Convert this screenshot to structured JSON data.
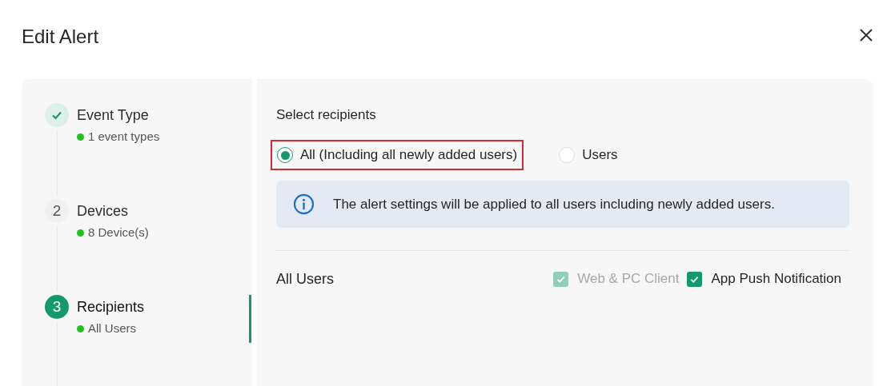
{
  "dialog": {
    "title": "Edit Alert"
  },
  "steps": [
    {
      "kind": "done",
      "selected": false,
      "title": "Event Type",
      "summary": "1 event types",
      "color": "#22c020"
    },
    {
      "kind": "numbered",
      "selected": false,
      "number": "2",
      "title": "Devices",
      "summary": "8 Device(s)",
      "color": "#22c020"
    },
    {
      "kind": "numbered",
      "selected": true,
      "number": "3",
      "title": "Recipients",
      "summary": "All Users",
      "color": "#22c020"
    }
  ],
  "recipients": {
    "heading": "Select recipients",
    "options": [
      {
        "label": "All (Including all newly added users)",
        "selected": true,
        "highlighted": true
      },
      {
        "label": "Users",
        "selected": false,
        "highlighted": false
      }
    ],
    "info": "The alert settings will be applied to all users including newly added users.",
    "group": {
      "label": "All Users",
      "channels": [
        {
          "label": "Web & PC Client",
          "checked": true,
          "disabled": true
        },
        {
          "label": "App Push Notification",
          "checked": true,
          "disabled": false
        }
      ]
    }
  }
}
